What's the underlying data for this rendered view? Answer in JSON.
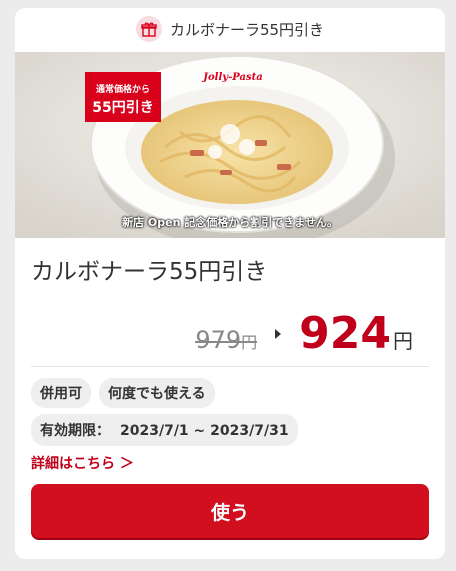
{
  "header": {
    "title": "カルボナーラ55円引き",
    "icon": "gift-icon"
  },
  "photo": {
    "ribbon_line1": "通常価格から",
    "ribbon_line2": "55円引き",
    "notice": "新店 Open 記念価格から割引できません。",
    "plate_logo": "Jolly-Pasta"
  },
  "coupon": {
    "title": "カルボナーラ55円引き",
    "old_price": "979",
    "old_price_unit": "円",
    "new_price": "924",
    "new_price_unit": "円"
  },
  "tags": [
    "併用可",
    "何度でも使える"
  ],
  "expiry": {
    "label": "有効期限：",
    "range": "2023/7/1 ~ 2023/7/31"
  },
  "details_link": "詳細はこちら ＞",
  "use_button": "使う",
  "colors": {
    "accent": "#d10f1f",
    "price": "#c0001b"
  }
}
